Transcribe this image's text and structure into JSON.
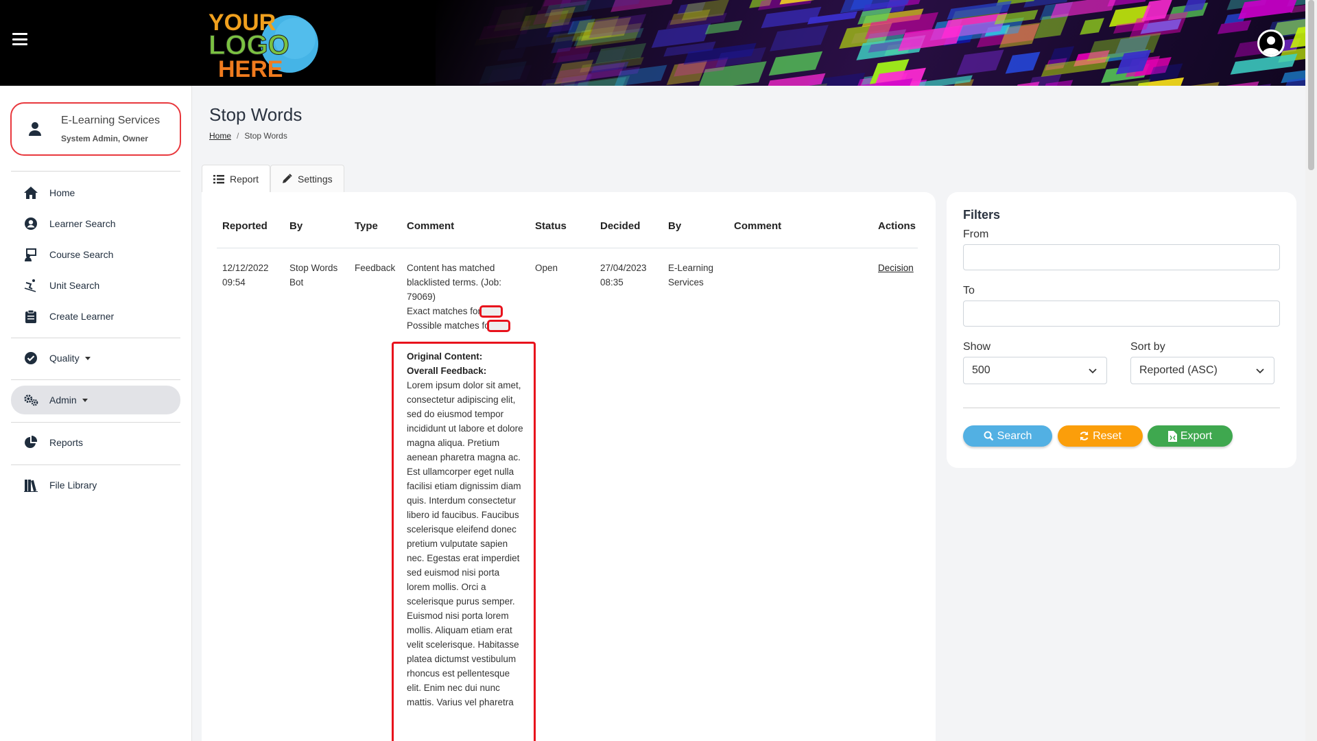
{
  "header": {
    "logo_text": "YOUR LOGO HERE"
  },
  "user": {
    "name": "E-Learning Services",
    "role": "System Admin, Owner"
  },
  "nav": {
    "home": "Home",
    "learner_search": "Learner Search",
    "course_search": "Course Search",
    "unit_search": "Unit Search",
    "create_learner": "Create Learner",
    "quality": "Quality",
    "admin": "Admin",
    "reports": "Reports",
    "file_library": "File Library"
  },
  "page": {
    "title": "Stop Words",
    "breadcrumb_home": "Home",
    "breadcrumb_current": "Stop Words"
  },
  "tabs": {
    "report": "Report",
    "settings": "Settings"
  },
  "table": {
    "headers": {
      "reported": "Reported",
      "by": "By",
      "type": "Type",
      "comment": "Comment",
      "status": "Status",
      "decided": "Decided",
      "by2": "By",
      "comment2": "Comment",
      "actions": "Actions"
    },
    "row": {
      "reported": "12/12/2022 09:54",
      "by": "Stop Words Bot",
      "type": "Feedback",
      "comment": "Content has matched blacklisted terms. (Job: 79069)",
      "exact_matches": "Exact matches for",
      "possible_matches": "Possible matches fo",
      "status": "Open",
      "decided": "27/04/2023 08:35",
      "decided_by": "E-Learning Services",
      "action": "Decision",
      "original_content_label": "Original Content:",
      "overall_feedback_label": "Overall Feedback:",
      "original_text": "Lorem ipsum dolor sit amet, consectetur adipiscing elit, sed do eiusmod tempor incididunt ut labore et dolore magna aliqua. Pretium aenean pharetra magna ac. Est ullamcorper eget nulla facilisi etiam dignissim diam quis. Interdum consectetur libero id faucibus. Faucibus scelerisque eleifend donec pretium vulputate sapien nec. Egestas erat imperdiet sed euismod nisi porta lorem mollis. Orci a scelerisque purus semper. Euismod nisi porta lorem mollis. Aliquam etiam erat velit scelerisque. Habitasse platea dictumst vestibulum rhoncus est pellentesque elit. Enim nec dui nunc mattis. Varius vel pharetra"
    }
  },
  "filters": {
    "title": "Filters",
    "from_label": "From",
    "from_value": "",
    "to_label": "To",
    "to_value": "",
    "show_label": "Show",
    "show_value": "500",
    "sort_label": "Sort by",
    "sort_value": "Reported (ASC)",
    "search_button": "Search",
    "reset_button": "Reset",
    "export_button": "Export"
  },
  "colors": {
    "accent_red": "#e8121c",
    "search_blue": "#52b0e3",
    "reset_orange": "#fb9e0a",
    "export_green": "#3fa84f"
  }
}
